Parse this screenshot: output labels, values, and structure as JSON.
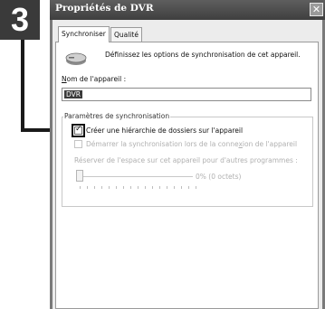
{
  "step": {
    "number": "3"
  },
  "window": {
    "title": "Propriétés de DVR",
    "close_glyph": "✕"
  },
  "tabs": [
    {
      "label": "Synchroniser",
      "active": true
    },
    {
      "label": "Qualité",
      "active": false
    }
  ],
  "sync": {
    "intro": "Définissez les options de synchronisation de cet appareil.",
    "device_icon": "device-icon",
    "name_label_underlined": "N",
    "name_label_rest": "om de l'appareil :",
    "name_value": "DVR",
    "group_title": "Paramètres de synchronisation",
    "create_hierarchy": {
      "label": "Créer une hiérarchie de dossiers sur l'appareil",
      "checked": true,
      "enabled": true
    },
    "start_sync_label_a": "Démarrer la synchronisation lors de la conne",
    "start_sync_label_u": "x",
    "start_sync_label_b": "ion de l'appareil",
    "start_sync_enabled": false,
    "reserve_label": "Réserver de l'espace sur cet appareil pour d'autres programmes :",
    "reserve_value": "0% (0 octets)",
    "reserve_percent": 0
  },
  "colors": {
    "badge": "#3a3a3a",
    "titlebar": "#4a4a4a",
    "disabled_text": "#b0b0b0"
  }
}
